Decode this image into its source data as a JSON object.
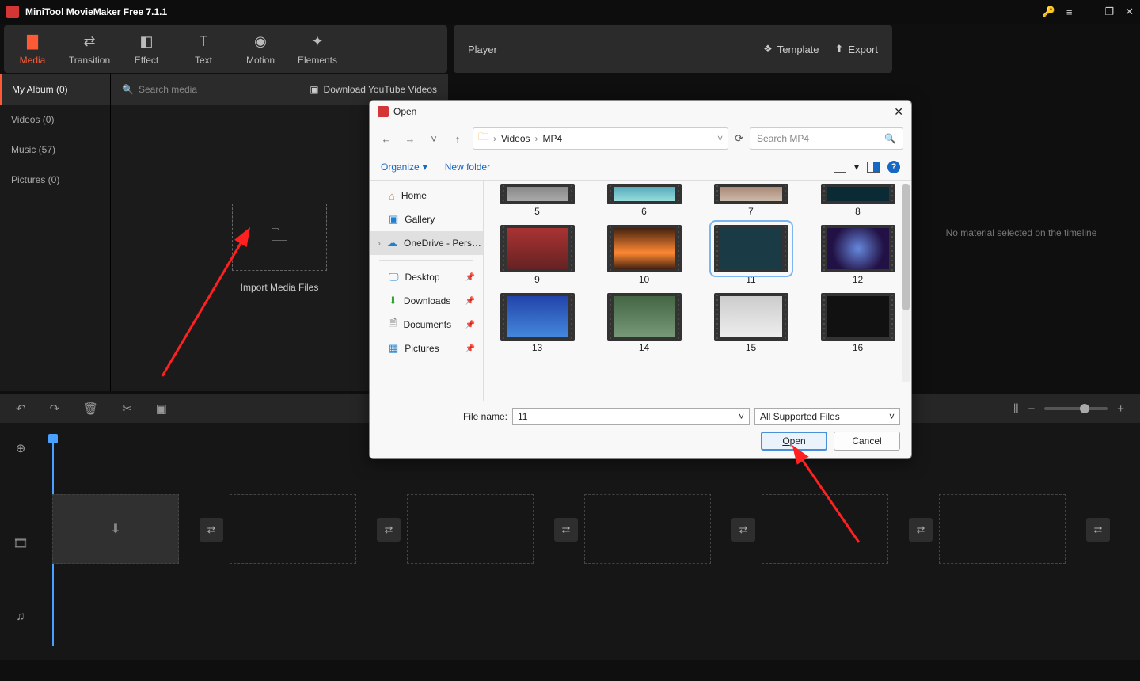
{
  "app": {
    "title": "MiniTool MovieMaker Free 7.1.1"
  },
  "tabs": {
    "media": "Media",
    "transition": "Transition",
    "effect": "Effect",
    "text": "Text",
    "motion": "Motion",
    "elements": "Elements"
  },
  "player": {
    "label": "Player",
    "template": "Template",
    "export": "Export"
  },
  "sidebar": {
    "album": "My Album (0)",
    "videos": "Videos (0)",
    "music": "Music (57)",
    "pictures": "Pictures (0)"
  },
  "search": {
    "placeholder": "Search media",
    "dl_youtube": "Download YouTube Videos"
  },
  "import_label": "Import Media Files",
  "right_empty": "No material selected on the timeline",
  "dialog": {
    "title": "Open",
    "breadcrumb": {
      "l1": "Videos",
      "l2": "MP4"
    },
    "search_placeholder": "Search MP4",
    "organize": "Organize",
    "new_folder": "New folder",
    "tree": {
      "home": "Home",
      "gallery": "Gallery",
      "onedrive": "OneDrive - Pers…",
      "desktop": "Desktop",
      "downloads": "Downloads",
      "documents": "Documents",
      "pictures": "Pictures"
    },
    "files": [
      "5",
      "6",
      "7",
      "8",
      "9",
      "10",
      "11",
      "12",
      "13",
      "14",
      "15",
      "16"
    ],
    "filename_label": "File name:",
    "filename_value": "11",
    "filter": "All Supported Files",
    "open": "Open",
    "cancel": "Cancel"
  }
}
